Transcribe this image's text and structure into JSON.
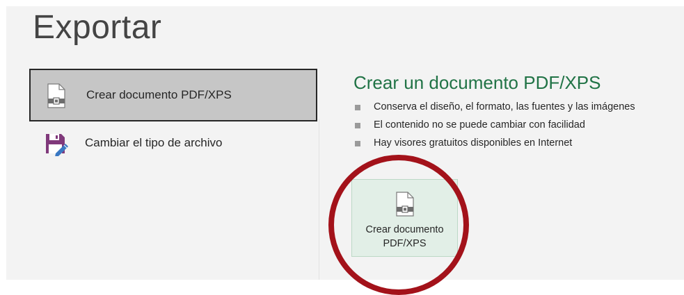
{
  "page": {
    "title": "Exportar"
  },
  "options": [
    {
      "label": "Crear documento PDF/XPS",
      "icon": "pdf-document-icon",
      "selected": true
    },
    {
      "label": "Cambiar el tipo de archivo",
      "icon": "save-as-icon",
      "selected": false
    }
  ],
  "detail": {
    "title": "Crear un documento PDF/XPS",
    "bullets": [
      "Conserva el diseño, el formato, las fuentes y las imágenes",
      "El contenido no se puede cambiar con facilidad",
      "Hay visores gratuitos disponibles en Internet"
    ],
    "button": {
      "line1": "Crear documento",
      "line2": "PDF/XPS",
      "icon": "pdf-document-icon"
    }
  },
  "colors": {
    "accent_green": "#217346",
    "highlight_ring": "#a3121a",
    "selected_bg": "#c6c6c6",
    "save_icon_purple": "#80397b"
  }
}
